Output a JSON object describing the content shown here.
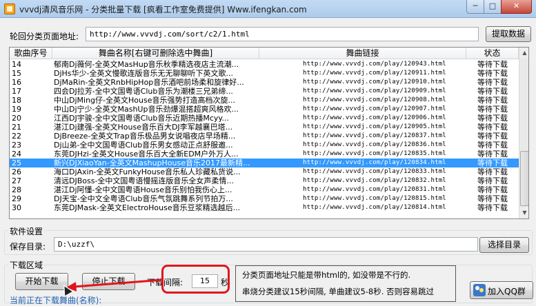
{
  "window": {
    "title": "vvvdj清风音乐网 - 分类批量下载 [疯看工作室免费提供] Www.ifengkan.com",
    "min_glyph": "─",
    "max_glyph": "□",
    "close_glyph": "✕"
  },
  "source": {
    "label": "轮回分类页面地址:",
    "url_value": "http://www.vvvdj.com/sort/c2/1.html",
    "fetch_button": "提取数据"
  },
  "table": {
    "columns": [
      "歌曲序号",
      "舞曲名称[右键可删除选中舞曲]",
      "舞曲链接",
      "状态"
    ],
    "rows": [
      {
        "no": "14",
        "name": "郁南Dj薇何-全英文MasHup音乐秋季精选夜店主流潮...",
        "link": "http://www.vvvdj.com/play/120943.html",
        "status": "等待下载"
      },
      {
        "no": "15",
        "name": "DjHs华少-全英文慢歌连版音乐无无聊聊听下英文歌...",
        "link": "http://www.vvvdj.com/play/120911.html",
        "status": "等待下载"
      },
      {
        "no": "16",
        "name": "DjMaRin-全英文RnbHipHop音乐酒吧前场柔和旋律好...",
        "link": "http://www.vvvdj.com/play/120910.html",
        "status": "等待下载"
      },
      {
        "no": "17",
        "name": "四会DJ拉芳-全中文国粤语Club音乐为潮楼三兄弟缔...",
        "link": "http://www.vvvdj.com/play/120909.html",
        "status": "等待下载"
      },
      {
        "no": "18",
        "name": "中山DjMing仔-全英文House音乐强势打造高档次旋...",
        "link": "http://www.vvvdj.com/play/120908.html",
        "status": "等待下载"
      },
      {
        "no": "19",
        "name": "中山Dj宁少-全英文MashUp音乐劲爆混搭超爽风格欢...",
        "link": "http://www.vvvdj.com/play/120907.html",
        "status": "等待下载"
      },
      {
        "no": "20",
        "name": "江西DJ宇骏-全中文国粤语Club音乐近期热播Mcyy...",
        "link": "http://www.vvvdj.com/play/120906.html",
        "status": "等待下载"
      },
      {
        "no": "21",
        "name": "湛江Dj建强-全英文House音乐百大DJ李军越襄巴塔...",
        "link": "http://www.vvvdj.com/play/120905.html",
        "status": "等待下载"
      },
      {
        "no": "22",
        "name": "DjBreeze-全英文Trap音乐极品男女说唱夜店早场精...",
        "link": "http://www.vvvdj.com/play/120837.html",
        "status": "等待下载"
      },
      {
        "no": "23",
        "name": "Dj山弟-全中文国粤语Club音乐男女感动正点舒服邀...",
        "link": "http://www.vvvdj.com/play/120836.html",
        "status": "等待下载"
      },
      {
        "no": "24",
        "name": "东莞DJHzi-全英文House音乐百大全新EDM户外万人...",
        "link": "http://www.vvvdj.com/play/120835.html",
        "status": "等待下载"
      },
      {
        "no": "25",
        "name": "新兴DJXiaoYan-全英文MashupHouse音乐2017最新精...",
        "link": "http://www.vvvdj.com/play/120834.html",
        "status": "等待下载"
      },
      {
        "no": "26",
        "name": "海口DjAxin-全英文FunkyHouse音乐私人珍藏私货说...",
        "link": "http://www.vvvdj.com/play/120833.html",
        "status": "等待下载"
      },
      {
        "no": "27",
        "name": "清远DJBoss-全中文国粤语慢摇连版音乐全女声柔情...",
        "link": "http://www.vvvdj.com/play/120832.html",
        "status": "等待下载"
      },
      {
        "no": "28",
        "name": "湛江Dj阿懂-全中文国粤语House音乐别怕我伤心上...",
        "link": "http://www.vvvdj.com/play/120831.html",
        "status": "等待下载"
      },
      {
        "no": "29",
        "name": "DJ天宝-全中文全粤语Club音乐气氛跳舞系列节拍万...",
        "link": "http://www.vvvdj.com/play/120815.html",
        "status": "等待下载"
      },
      {
        "no": "30",
        "name": "东莞DJMask-全英文ElectroHouse音乐豆浆精选越后...",
        "link": "http://www.vvvdj.com/play/120814.html",
        "status": "等待下载"
      }
    ],
    "selected_row_index": 11
  },
  "settings": {
    "group_title": "软件设置",
    "save_label": "保存目录:",
    "save_value": "D:\\uzzf\\",
    "choose_button": "选择目录"
  },
  "download": {
    "group_title": "下载区域",
    "start_button": "开始下载",
    "stop_button": "停止下载",
    "interval_label": "下载间隔:",
    "interval_value": "15",
    "interval_unit": "秒",
    "current_label": "当前正在下载舞曲(名称):"
  },
  "hints": {
    "line1": "分类页面地址只能是带html的, 如没带是不行的.",
    "line2": "串烧分类建议15秒间隔, 单曲建议5-8秒. 否则容易跳过"
  },
  "qq": {
    "label": "加入QQ群"
  },
  "colors": {
    "selection": "#3399ff",
    "annotation": "#e0161c"
  }
}
